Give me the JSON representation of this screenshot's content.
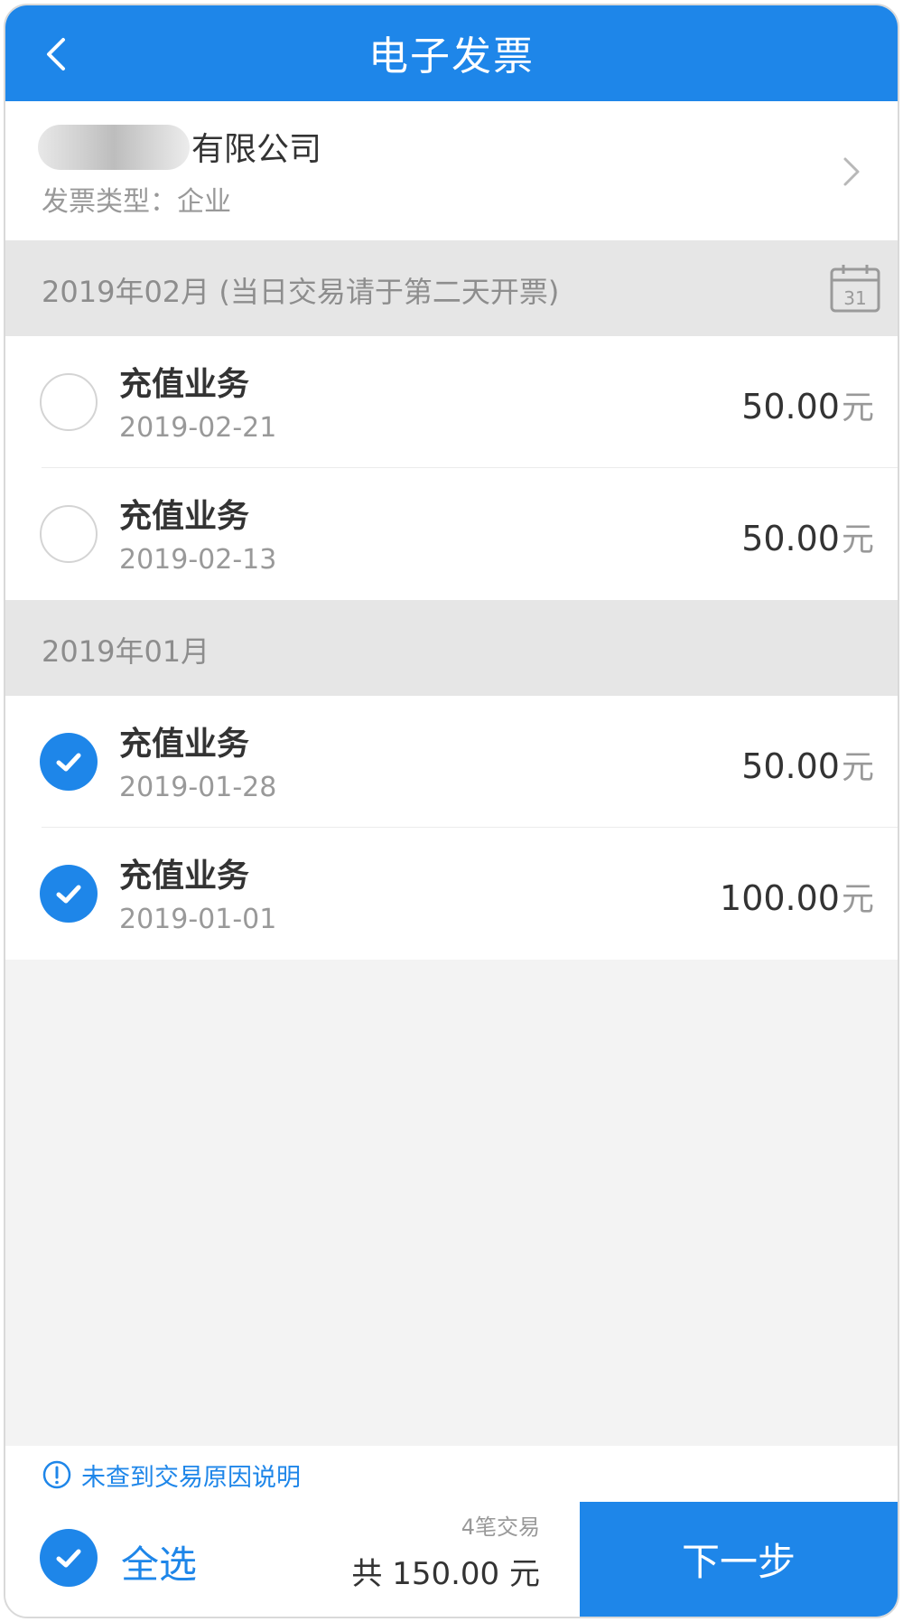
{
  "header": {
    "title": "电子发票"
  },
  "company": {
    "name_suffix": "有限公司",
    "type_label": "发票类型：企业"
  },
  "sections": [
    {
      "label": "2019年02月 (当日交易请于第二天开票)",
      "calendar_day": "31",
      "items": [
        {
          "name": "充值业务",
          "date": "2019-02-21",
          "amount": "50.00",
          "unit": "元",
          "checked": false
        },
        {
          "name": "充值业务",
          "date": "2019-02-13",
          "amount": "50.00",
          "unit": "元",
          "checked": false
        }
      ]
    },
    {
      "label": "2019年01月",
      "items": [
        {
          "name": "充值业务",
          "date": "2019-01-28",
          "amount": "50.00",
          "unit": "元",
          "checked": true
        },
        {
          "name": "充值业务",
          "date": "2019-01-01",
          "amount": "100.00",
          "unit": "元",
          "checked": true
        }
      ]
    }
  ],
  "footer": {
    "notice": "未查到交易原因说明",
    "select_all": "全选",
    "count_text": "4笔交易",
    "total_text": "共 150.00 元",
    "next_label": "下一步"
  },
  "colors": {
    "primary": "#1e86e9",
    "section_bg": "#e6e6e6",
    "page_bg": "#f3f3f3"
  }
}
